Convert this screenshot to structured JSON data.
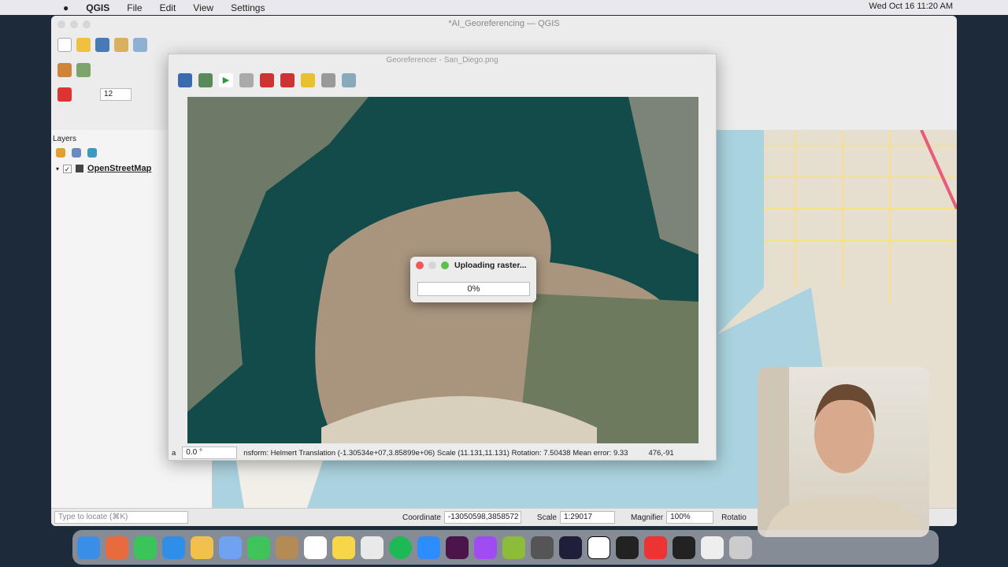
{
  "menubar": {
    "app": "QGIS",
    "items": [
      "File",
      "Edit",
      "View",
      "Settings"
    ],
    "clock": "Wed Oct 16  11:20 AM"
  },
  "qgis": {
    "title": "*AI_Georeferencing — QGIS",
    "scale_input": "12",
    "layers": {
      "title": "Layers",
      "items": [
        {
          "name": "OpenStreetMap",
          "checked": true
        }
      ]
    },
    "status": {
      "locate_placeholder": "Type to locate (⌘K)",
      "coordinate_label": "Coordinate",
      "coordinate": "-13050598,3858572",
      "scale_label": "Scale",
      "scale": "1:29017",
      "magnifier_label": "Magnifier",
      "magnifier": "100%",
      "rotation_label": "Rotatio"
    }
  },
  "georeferencer": {
    "title": "Georeferencer - San_Diego.png",
    "rotation_prefix": "a",
    "rotation": "0.0 °",
    "transform_text": "nsform: Helmert Translation (-1.30534e+07,3.85899e+06) Scale (11.131,11.131) Rotation: 7.50438 Mean error: 9.33",
    "coords": "476,-91"
  },
  "dialog": {
    "title": "Uploading raster...",
    "progress_text": "0%",
    "progress": 0
  },
  "colors": {
    "water": "#124b4a",
    "land": "#b9a58b",
    "osm_bg": "#e6dfd0"
  }
}
